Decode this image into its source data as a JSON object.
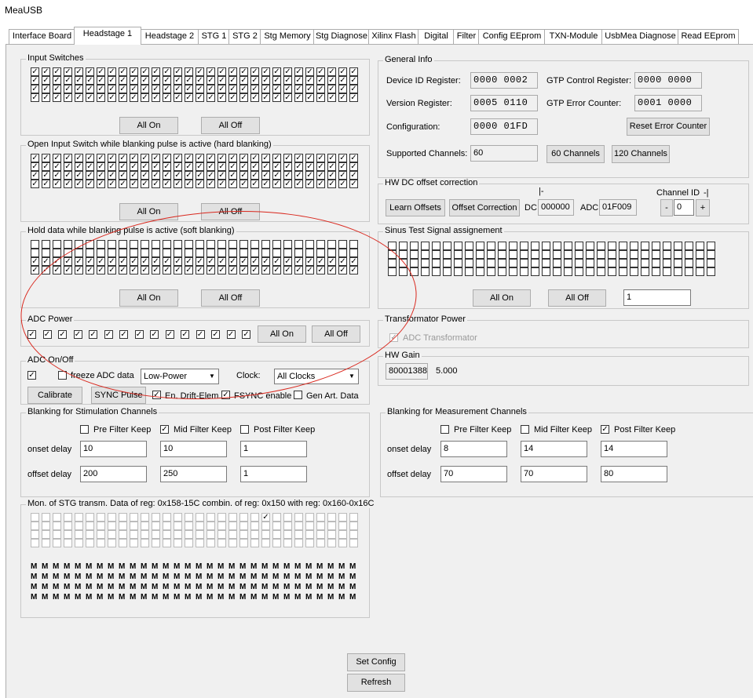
{
  "window": {
    "title": "MeaUSB"
  },
  "tabs": [
    "Interface Board",
    "Headstage 1",
    "Headstage 2",
    "STG 1",
    "STG 2",
    "Stg Memory",
    "Stg Diagnose",
    "Xilinx Flash",
    "Digital",
    "Filter",
    "Config EEprom",
    "TXN-Module",
    "UsbMea Diagnose",
    "Read EEprom"
  ],
  "active_tab": "Headstage 1",
  "input_switches": {
    "title": "Input Switches",
    "rows": [
      [
        1,
        1,
        1,
        1,
        1,
        1,
        1,
        1,
        1,
        1,
        1,
        1,
        1,
        1,
        1,
        1,
        1,
        1,
        1,
        1,
        1,
        1,
        1,
        1,
        1,
        1,
        1,
        1,
        1,
        1,
        1,
        1,
        1,
        1,
        1,
        1,
        1,
        1,
        1,
        1
      ],
      [
        1,
        1,
        1,
        1,
        1,
        1,
        1,
        1,
        1,
        1,
        1,
        1,
        1,
        1,
        1,
        1,
        1,
        1,
        1,
        1,
        1,
        1,
        1,
        1,
        1,
        1,
        1,
        1,
        1,
        1,
        1,
        1,
        1,
        1,
        1,
        1,
        1,
        1,
        1,
        1
      ]
    ],
    "all_on": "All On",
    "all_off": "All Off"
  },
  "hard_blanking": {
    "title": "Open Input Switch while blanking pulse is active (hard blanking)",
    "all_on": "All On",
    "all_off": "All Off"
  },
  "soft_blanking": {
    "title": "Hold data while blanking pulse is active (soft blanking)",
    "all_on": "All On",
    "all_off": "All Off"
  },
  "adc_power": {
    "title": "ADC Power",
    "all_on": "All On",
    "all_off": "All Off"
  },
  "adc_onoff": {
    "title": "ADC On/Off",
    "freeze": "freeze ADC data",
    "mode": "Low-Power",
    "clock_label": "Clock:",
    "clock": "All Clocks",
    "calibrate": "Calibrate",
    "sync": "SYNC Pulse",
    "drift": "En. Drift-Elem.",
    "fsync": "FSYNC enable",
    "genart": "Gen Art. Data"
  },
  "blank_stim": {
    "title": "Blanking for Stimulation Channels",
    "pre": "Pre Filter Keep",
    "mid": "Mid Filter Keep",
    "post": "Post Filter Keep",
    "onset_label": "onset delay",
    "offset_label": "offset delay",
    "onset": [
      "10",
      "10",
      "1"
    ],
    "offset": [
      "200",
      "250",
      "1"
    ]
  },
  "blank_meas": {
    "title": "Blanking for Measurement Channels",
    "pre": "Pre Filter Keep",
    "mid": "Mid Filter Keep",
    "post": "Post Filter Keep",
    "onset_label": "onset delay",
    "offset_label": "offset delay",
    "onset": [
      "8",
      "14",
      "14"
    ],
    "offset": [
      "70",
      "70",
      "80"
    ]
  },
  "monitor": {
    "title": "Mon. of STG transm. Data of reg: 0x158-15C  combin. of reg: 0x150 with reg: 0x160-0x16C",
    "glyph": "M"
  },
  "general": {
    "title": "General Info",
    "device_id_label": "Device ID Register:",
    "device_id": "0000 0002",
    "version_label": "Version Register:",
    "version": "0005 0110",
    "config_label": "Configuration:",
    "config": "0000 01FD",
    "gtp_ctrl_label": "GTP Control Register:",
    "gtp_ctrl": "0000 0000",
    "gtp_err_label": "GTP Error Counter:",
    "gtp_err": "0001 0000",
    "reset": "Reset Error Counter",
    "channels_label": "Supported Channels:",
    "channels": "60",
    "btn60": "60 Channels",
    "btn120": "120 Channels"
  },
  "hwdc": {
    "title": "HW DC offset correction",
    "learn": "Learn Offsets",
    "offset_corr": "Offset Correction",
    "dc_label": "DC",
    "dc": "000000",
    "adc_label": "ADC",
    "adc": "01F009",
    "bar_left": "|-",
    "chan_label": "Channel ID",
    "bar_right": "-|",
    "minus": "-",
    "chan": "0",
    "plus": "+"
  },
  "sinus": {
    "title": "Sinus Test Signal assignement",
    "all_on": "All On",
    "all_off": "All Off",
    "value": "1"
  },
  "transformer": {
    "title": "Transformator Power",
    "label": "ADC Transformator"
  },
  "hwgain": {
    "title": "HW Gain",
    "value": "80001388",
    "gain": "5.000"
  },
  "footer": {
    "set_config": "Set Config",
    "refresh": "Refresh"
  }
}
